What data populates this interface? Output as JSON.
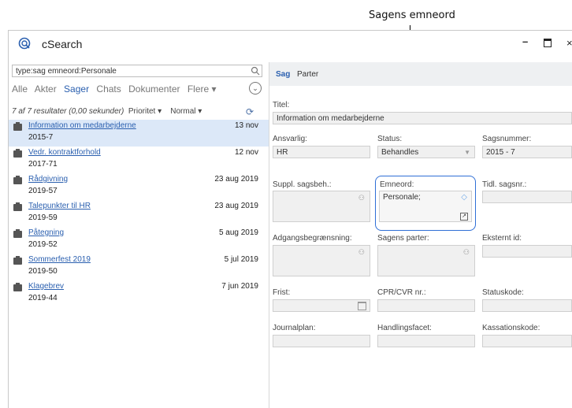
{
  "callout": "Sagens emneord",
  "window": {
    "title": "cSearch",
    "minimize": "–",
    "close": "×"
  },
  "search": {
    "value": "type:sag emneord:Personale"
  },
  "filters": {
    "items": [
      "Alle",
      "Akter",
      "Sager",
      "Chats",
      "Dokumenter",
      "Flere ▾"
    ],
    "active": "Sager"
  },
  "results_status": {
    "summary": "7 af 7 resultater (0,00 sekunder)",
    "priority_label": "Prioritet ▾",
    "normal_label": "Normal ▾"
  },
  "results": [
    {
      "title": "Information om medarbejderne",
      "number": "2015-7",
      "date": "13 nov"
    },
    {
      "title": "Vedr. kontraktforhold",
      "number": "2017-71",
      "date": "12 nov"
    },
    {
      "title": "Rådgivning",
      "number": "2019-57",
      "date": "23 aug 2019"
    },
    {
      "title": "Talepunkter til HR",
      "number": "2019-59",
      "date": "23 aug 2019"
    },
    {
      "title": "Påtegning",
      "number": "2019-52",
      "date": "5 aug 2019"
    },
    {
      "title": "Sommerfest 2019",
      "number": "2019-50",
      "date": "5 jul 2019"
    },
    {
      "title": "Klagebrev",
      "number": "2019-44",
      "date": "7 jun 2019"
    }
  ],
  "tabs": {
    "sag": "Sag",
    "parter": "Parter"
  },
  "form": {
    "titel_label": "Titel:",
    "titel_value": "Information om medarbejderne",
    "ansvarlig_label": "Ansvarlig:",
    "ansvarlig_value": "HR",
    "status_label": "Status:",
    "status_value": "Behandles",
    "sagsnummer_label": "Sagsnummer:",
    "sagsnummer_value": "2015 - 7",
    "suppl_label": "Suppl. sagsbeh.:",
    "emneord_label": "Emneord:",
    "emneord_value": "Personale;",
    "tidl_label": "Tidl. sagsnr.:",
    "adgang_label": "Adgangsbegrænsning:",
    "parter_label": "Sagens parter:",
    "eksternt_label": "Eksternt id:",
    "frist_label": "Frist:",
    "cpr_label": "CPR/CVR nr.:",
    "statuskode_label": "Statuskode:",
    "journal_label": "Journalplan:",
    "handling_label": "Handlingsfacet:",
    "kassation_label": "Kassationskode:"
  },
  "colors": {
    "accent": "#2a5faf",
    "highlight_border": "#2f6fd6",
    "selected_row": "#dce8f8"
  }
}
